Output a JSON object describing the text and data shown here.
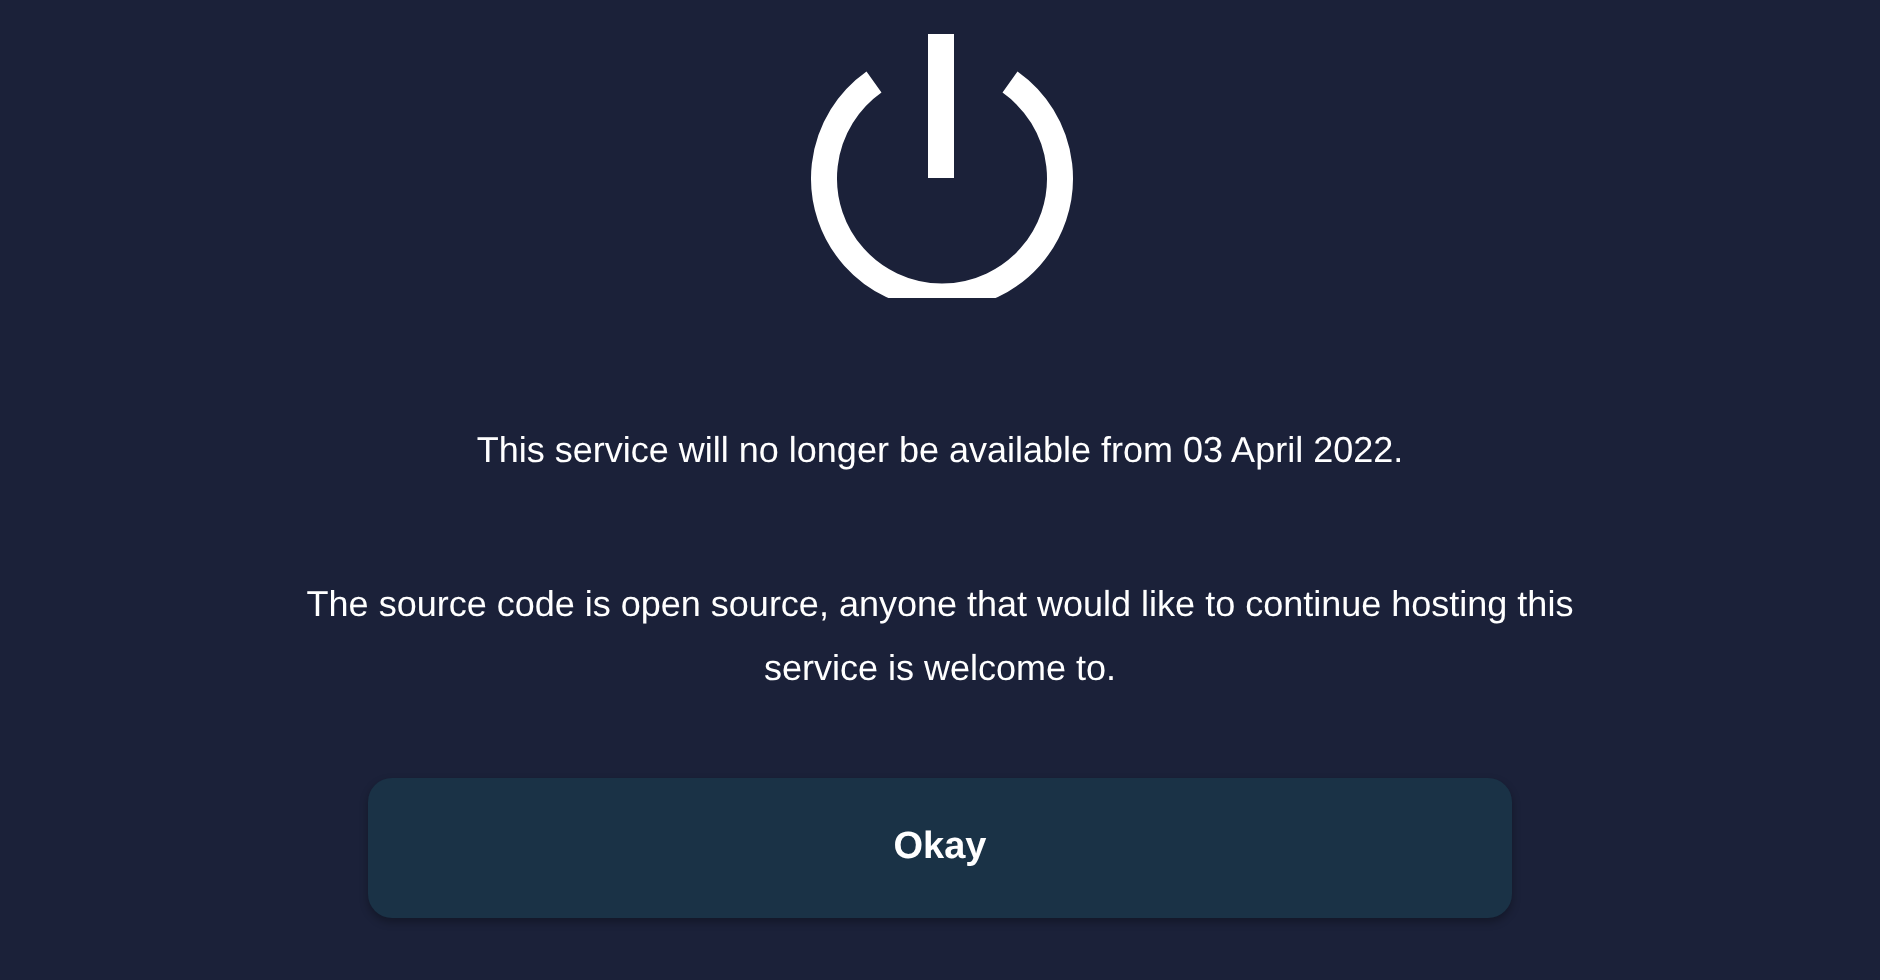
{
  "notice": {
    "message": "This service will no longer be available from 03 April 2022.",
    "detail": "The source code is open source, anyone that would like to continue hosting this service is welcome to."
  },
  "buttons": [
    {
      "label": "Okay"
    }
  ]
}
